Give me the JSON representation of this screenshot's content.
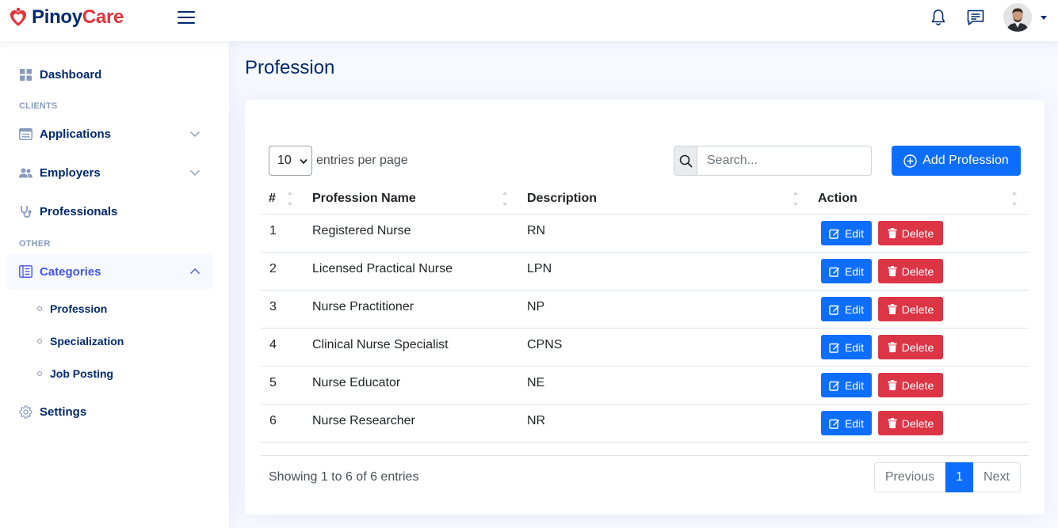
{
  "brand": {
    "name_part1": "Pinoy",
    "name_part2": "Care",
    "color_dark": "#012970",
    "color_red": "#e5333a"
  },
  "header": {
    "icons": [
      "bell-icon",
      "chat-icon"
    ],
    "accent": "#4154f1"
  },
  "sidebar": {
    "dashboard": "Dashboard",
    "heading_clients": "CLIENTS",
    "applications": "Applications",
    "employers": "Employers",
    "professionals": "Professionals",
    "heading_other": "OTHER",
    "categories": "Categories",
    "sub_items": [
      "Profession",
      "Specialization",
      "Job Posting"
    ],
    "settings": "Settings"
  },
  "page": {
    "title": "Profession"
  },
  "table_controls": {
    "entries_value": "10",
    "entries_label": "entries per page",
    "search_placeholder": "Search...",
    "add_button": "Add Profession"
  },
  "columns": [
    "#",
    "Profession Name",
    "Description",
    "Action"
  ],
  "rows": [
    {
      "num": "1",
      "name": "Registered Nurse",
      "desc": "RN"
    },
    {
      "num": "2",
      "name": "Licensed Practical Nurse",
      "desc": "LPN"
    },
    {
      "num": "3",
      "name": "Nurse Practitioner",
      "desc": "NP"
    },
    {
      "num": "4",
      "name": "Clinical Nurse Specialist",
      "desc": "CPNS"
    },
    {
      "num": "5",
      "name": "Nurse Educator",
      "desc": "NE"
    },
    {
      "num": "6",
      "name": "Nurse Researcher",
      "desc": "NR"
    }
  ],
  "row_actions": {
    "edit": "Edit",
    "delete": "Delete"
  },
  "footer": {
    "info": "Showing 1 to 6 of 6 entries",
    "prev": "Previous",
    "current": "1",
    "next": "Next"
  },
  "colors": {
    "primary": "#0d6efd",
    "danger": "#dc3545"
  }
}
